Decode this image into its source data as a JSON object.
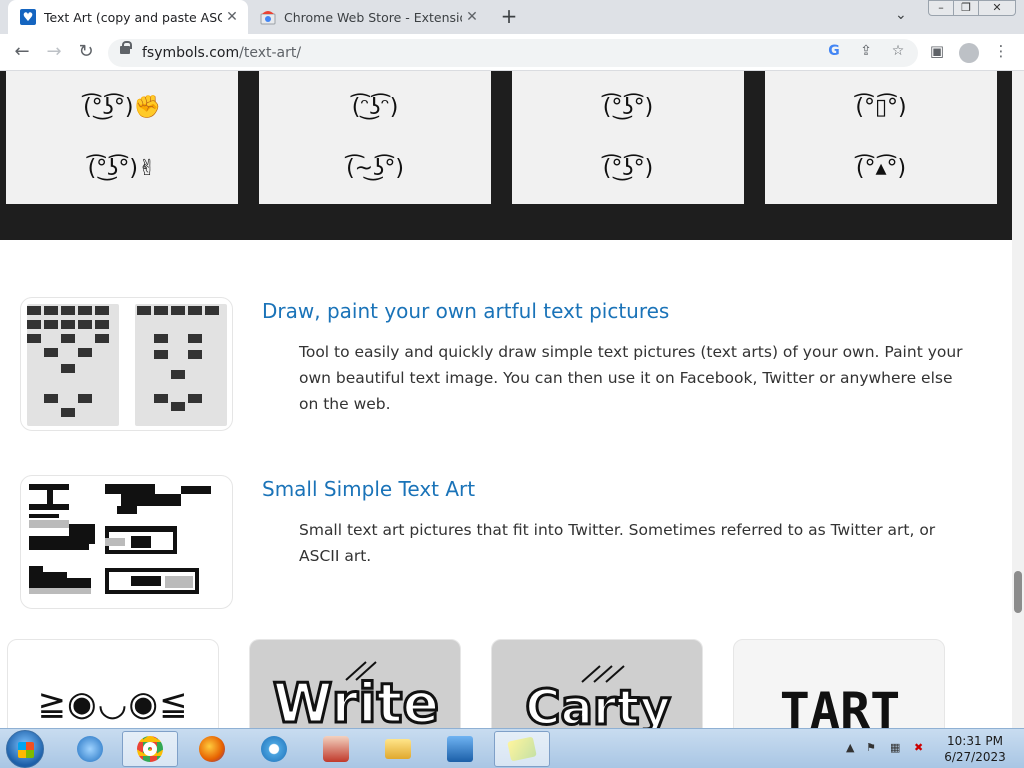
{
  "browser": {
    "tabs": [
      {
        "title": "Text Art (copy and paste ASCII pictures)",
        "active": true
      },
      {
        "title": "Chrome Web Store - Extensions",
        "active": false
      }
    ],
    "new_tab": "+",
    "tab_close": "✕",
    "url_host": "fsymbols.com",
    "url_path": "/text-art/"
  },
  "page": {
    "face_cards": [
      {
        "top": "(͡°͜ʖ͡°)✊",
        "bottom": "(͡°͜ʖ͡°)✌"
      },
      {
        "top": "(͡ᵔ͜ʖ͡ᵔ)",
        "bottom": "(͡~͜ʖ͡°)"
      },
      {
        "top": "(͡°͜ʖ͡°)",
        "bottom": "(͡°͜ʖ͡°)"
      },
      {
        "top": "(͡°▯͡°)",
        "bottom": "(͡°▴͡°)"
      }
    ],
    "features": [
      {
        "title": "Draw, paint your own artful text pictures",
        "description": "Tool to easily and quickly draw simple text pictures (text arts) of your own. Paint your own beautiful text image. You can then use it on Facebook, Twitter or anywhere else on the web."
      },
      {
        "title": "Small Simple Text Art",
        "description": "Small text art pictures that fit into Twitter. Sometimes referred to as Twitter art, or ASCII art."
      }
    ],
    "thumbnails": [
      {
        "text": "≧◉◡◉≦"
      },
      {
        "text": "Write"
      },
      {
        "text": "Carty"
      },
      {
        "text": "TART"
      }
    ]
  },
  "taskbar": {
    "time": "10:31 PM",
    "date": "6/27/2023"
  },
  "colors": {
    "link": "#1a73b8",
    "dark_band": "#1e1e1e",
    "card": "#f1f1f1"
  }
}
